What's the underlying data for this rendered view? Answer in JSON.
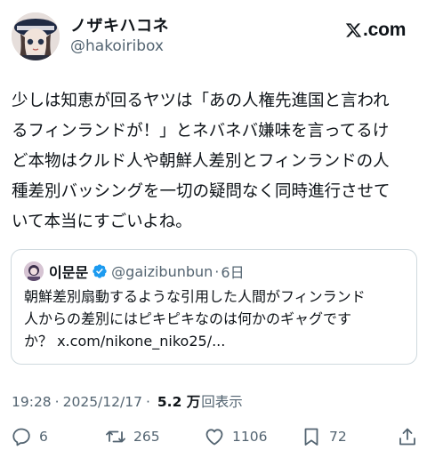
{
  "author": {
    "display_name": "ノザキハコネ",
    "handle": "@hakoiribox"
  },
  "brand": {
    "text": ".com"
  },
  "tweet": {
    "lines": [
      "少しは知恵が回るヤツは「あの人権先進国と言われ",
      "るフィンランドが！」とネバネバ嫌味を言ってるけ",
      "ど本物はクルド人や朝鮮人差別とフィンランドの人",
      "種差別バッシングを一切の疑問なく同時進行させて",
      "いて本当にすごいよね。"
    ]
  },
  "quote": {
    "name": "이문문",
    "handle": "@gaizibunbun",
    "separator": "·",
    "time": "6日",
    "lines": [
      "朝鮮差別扇動するような引用した人間がフィンランド",
      "人からの差別にはピキピキなのは何かのギャグです",
      "か？ x.com/nikone_niko25/..."
    ]
  },
  "meta": {
    "time": "19:28",
    "separator": "·",
    "date": "2025/12/17",
    "separator2": "·",
    "views": "5.2 万",
    "views_label": "回表示"
  },
  "actions": {
    "replies": "6",
    "reposts": "265",
    "likes": "1106",
    "bookmarks": "72"
  },
  "colors": {
    "text": "#0f1419",
    "secondary": "#536471",
    "border": "#cfd9de",
    "verified": "#1d9bf0"
  }
}
